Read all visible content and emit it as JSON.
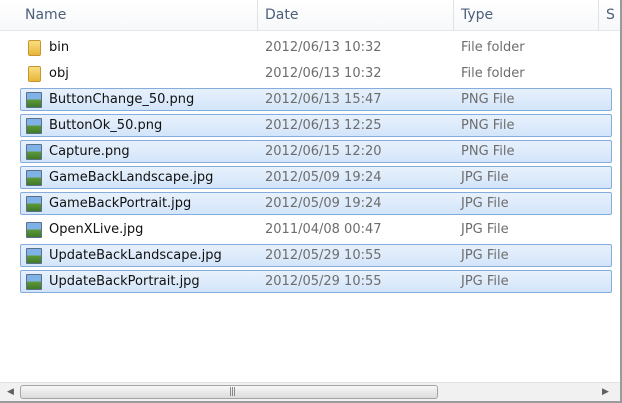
{
  "columns": {
    "name": "Name",
    "date": "Date",
    "type": "Type",
    "size": "S"
  },
  "files": [
    {
      "name": "bin",
      "date": "2012/06/13 10:32",
      "type": "File folder",
      "icon": "folder-icon",
      "selected": false
    },
    {
      "name": "obj",
      "date": "2012/06/13 10:32",
      "type": "File folder",
      "icon": "folder-icon",
      "selected": false
    },
    {
      "name": "ButtonChange_50.png",
      "date": "2012/06/13 15:47",
      "type": "PNG File",
      "icon": "image-icon",
      "selected": true
    },
    {
      "name": "ButtonOk_50.png",
      "date": "2012/06/13 12:25",
      "type": "PNG File",
      "icon": "image-icon",
      "selected": true
    },
    {
      "name": "Capture.png",
      "date": "2012/06/15 12:20",
      "type": "PNG File",
      "icon": "image-icon",
      "selected": true
    },
    {
      "name": "GameBackLandscape.jpg",
      "date": "2012/05/09 19:24",
      "type": "JPG File",
      "icon": "image-icon",
      "selected": true
    },
    {
      "name": "GameBackPortrait.jpg",
      "date": "2012/05/09 19:24",
      "type": "JPG File",
      "icon": "image-icon",
      "selected": true
    },
    {
      "name": "OpenXLive.jpg",
      "date": "2011/04/08 00:47",
      "type": "JPG File",
      "icon": "image-icon",
      "selected": false
    },
    {
      "name": "UpdateBackLandscape.jpg",
      "date": "2012/05/29 10:55",
      "type": "JPG File",
      "icon": "image-icon",
      "selected": true
    },
    {
      "name": "UpdateBackPortrait.jpg",
      "date": "2012/05/29 10:55",
      "type": "JPG File",
      "icon": "image-icon",
      "selected": true
    }
  ],
  "scrollbar": {
    "left_icon": "arrow-left-icon",
    "right_icon": "arrow-right-icon",
    "grip_icon": "grip-icon"
  },
  "colors": {
    "selection_fill": "#dbe9fb",
    "selection_border": "#84acdd",
    "header_text": "#4c607a",
    "secondary_text": "#6d6d6d"
  }
}
